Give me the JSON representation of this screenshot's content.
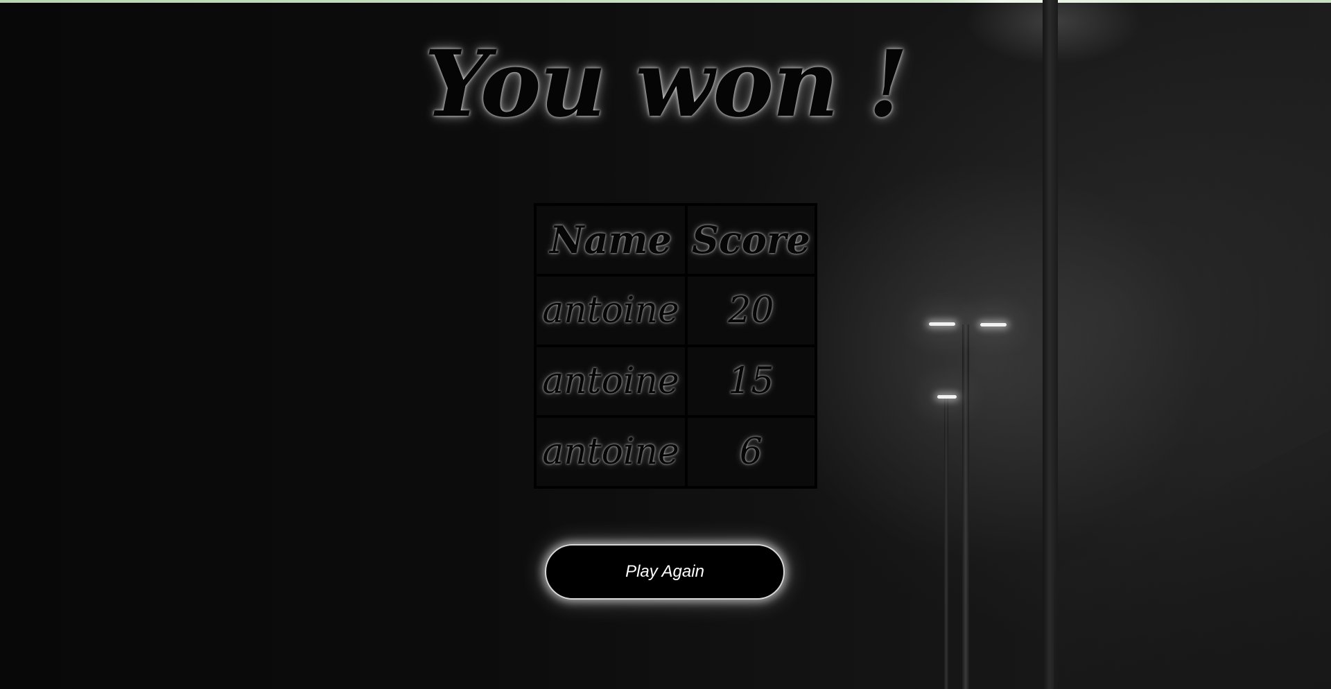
{
  "header": {
    "title": "You won !"
  },
  "leaderboard": {
    "columns": [
      "Name",
      "Score"
    ],
    "rows": [
      {
        "name": "antoine",
        "score": "20"
      },
      {
        "name": "antoine",
        "score": "15"
      },
      {
        "name": "antoine",
        "score": "6"
      }
    ]
  },
  "actions": {
    "play_again_label": "Play Again"
  },
  "colors": {
    "background": "#0b0b0b",
    "text": "#050505",
    "glow": "#ffffff",
    "button_bg": "#000000",
    "top_strip": "#cfe6c8"
  }
}
